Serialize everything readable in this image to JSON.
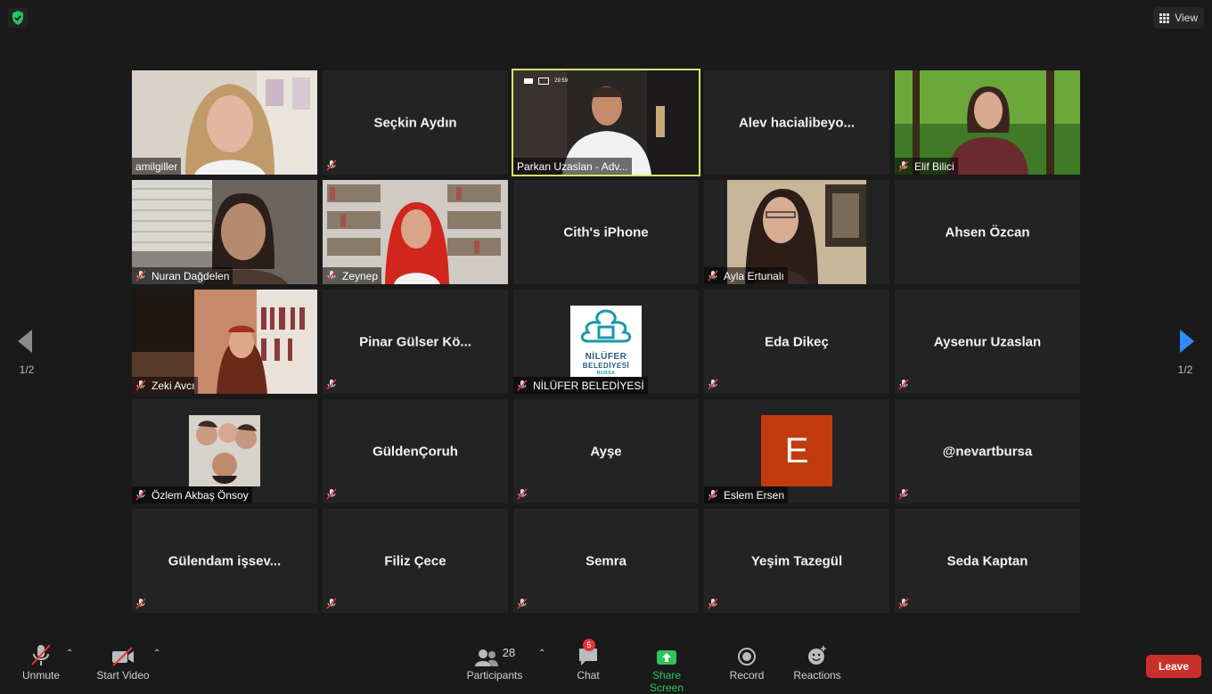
{
  "header": {
    "view_label": "View"
  },
  "pagination": {
    "left_label": "1/2",
    "right_label": "1/2"
  },
  "tiles": [
    {
      "name": "amilgiller",
      "mode": "video",
      "muted": false
    },
    {
      "name": "Seçkin Aydın",
      "mode": "name",
      "muted": true
    },
    {
      "name": "Parkan Uzaslan - Adv...",
      "mode": "video",
      "muted": false,
      "active": true,
      "clock": "29:59"
    },
    {
      "name": "Alev  hacialibeyo...",
      "mode": "name",
      "muted": false
    },
    {
      "name": "Elif Bilici",
      "mode": "video",
      "muted": true
    },
    {
      "name": "Nuran Dağdelen",
      "mode": "video",
      "muted": true
    },
    {
      "name": "Zeynep",
      "mode": "video",
      "muted": true
    },
    {
      "name": "Cith's iPhone",
      "mode": "name",
      "muted": false
    },
    {
      "name": "Ayla Ertunalı",
      "mode": "picture",
      "muted": true
    },
    {
      "name": "Ahsen Özcan",
      "mode": "name",
      "muted": false
    },
    {
      "name": "Zeki Avcı",
      "mode": "video",
      "muted": true
    },
    {
      "name": "Pinar Gülser Kö...",
      "mode": "name",
      "muted": true
    },
    {
      "name": "NİLÜFER BELEDİYESİ",
      "mode": "picture",
      "muted": true,
      "logo_line1": "NİLÜFER",
      "logo_line2": "BELEDİYESİ",
      "logo_line3": "BURSA"
    },
    {
      "name": "Eda Dikeç",
      "mode": "name",
      "muted": true
    },
    {
      "name": "Aysenur Uzaslan",
      "mode": "name",
      "muted": true
    },
    {
      "name": "Özlem Akbaş Önsoy",
      "mode": "picture",
      "muted": true
    },
    {
      "name": "GüldenÇoruh",
      "mode": "name",
      "muted": true
    },
    {
      "name": "Ayşe",
      "mode": "name",
      "muted": true
    },
    {
      "name": "Eslem Ersen",
      "mode": "letter",
      "muted": true,
      "letter": "E"
    },
    {
      "name": "@nevartbursa",
      "mode": "name",
      "muted": true
    },
    {
      "name": "Gülendam  işsev...",
      "mode": "name",
      "muted": true
    },
    {
      "name": "Filiz Çece",
      "mode": "name",
      "muted": true
    },
    {
      "name": "Semra",
      "mode": "name",
      "muted": true
    },
    {
      "name": "Yeşim Tazegül",
      "mode": "name",
      "muted": true
    },
    {
      "name": "Seda Kaptan",
      "mode": "name",
      "muted": true
    }
  ],
  "toolbar": {
    "unmute": "Unmute",
    "start_video": "Start Video",
    "participants": "Participants",
    "participants_count": "28",
    "chat": "Chat",
    "chat_badge": "5",
    "share_screen": "Share Screen",
    "record": "Record",
    "reactions": "Reactions",
    "leave": "Leave"
  },
  "colors": {
    "active_border": "#d6e86a",
    "share_green": "#2fc457",
    "leave_red": "#c9302c",
    "arrow_blue": "#2d8cff",
    "letter_avatar": "#c13b0e"
  }
}
